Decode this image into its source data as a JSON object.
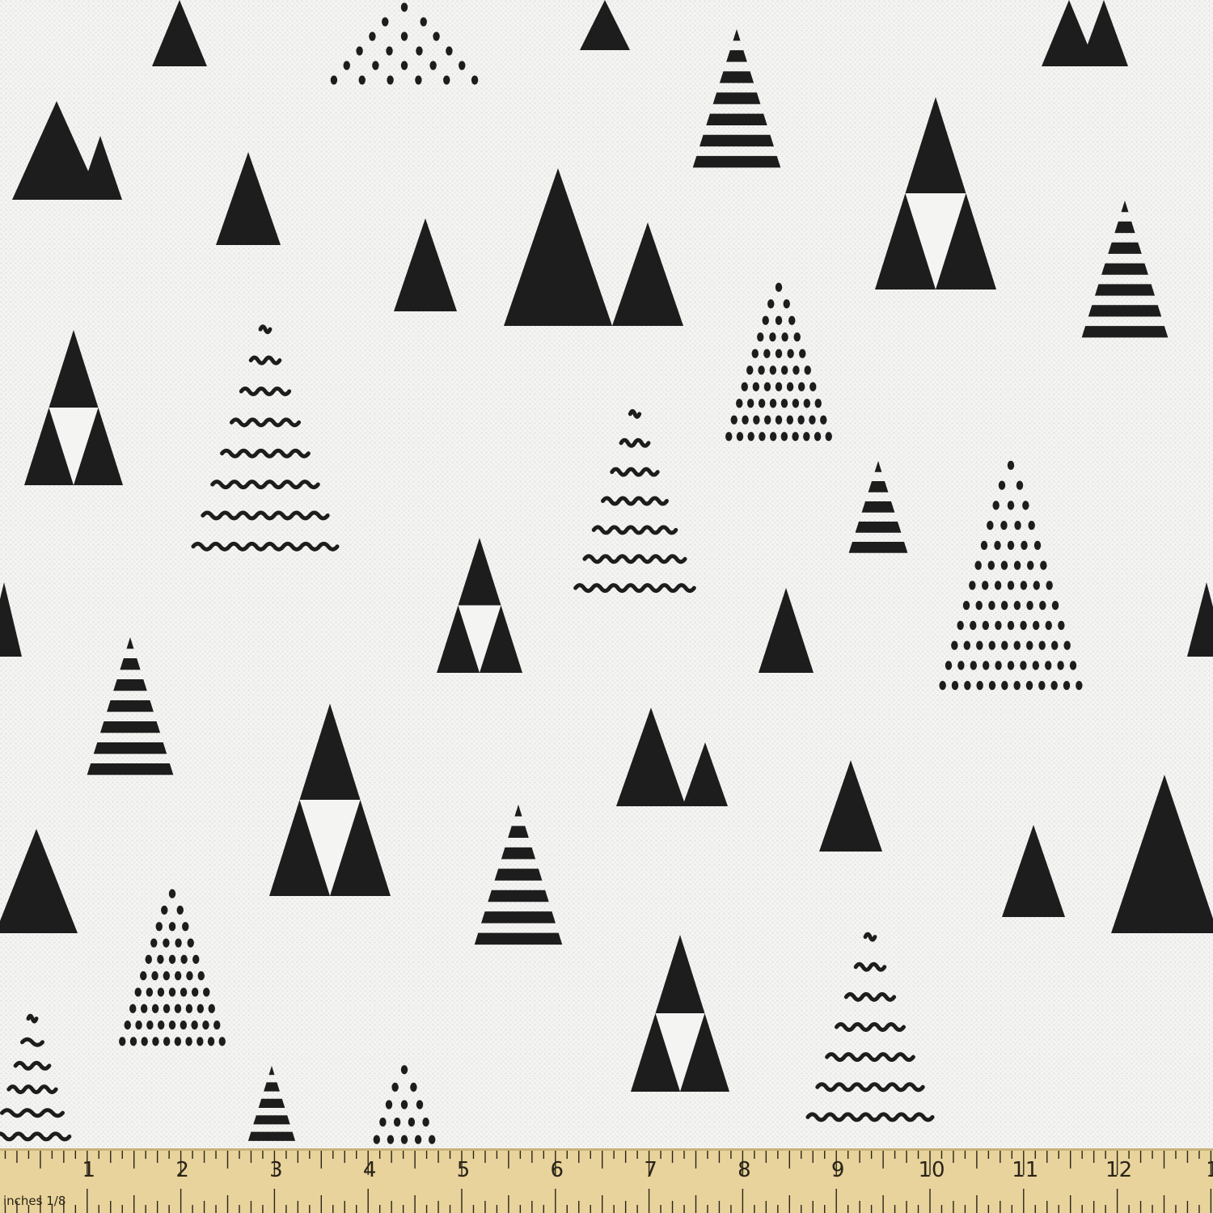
{
  "fabric": {
    "background_color": "#f4f4f2",
    "ink_color": "#1d1d1d",
    "motifs": [
      "solid-triangle",
      "double-mountain",
      "quad-triangle",
      "striped-triangle",
      "dotted-triangle",
      "zigzag-triangle"
    ]
  },
  "ruler": {
    "unit_label": "inches 1/8",
    "numbers": [
      "1",
      "2",
      "3",
      "4",
      "5",
      "6",
      "7",
      "8",
      "9",
      "10",
      "11",
      "12",
      "1"
    ],
    "wood_color": "#e8d39c",
    "mark_color": "#2a2418"
  }
}
